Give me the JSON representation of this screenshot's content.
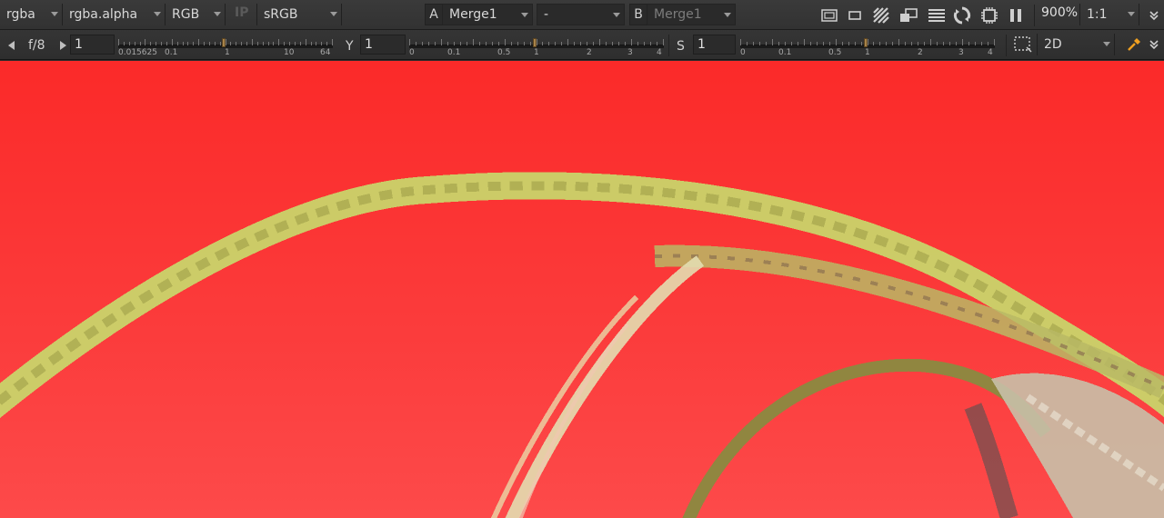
{
  "toolbar_top": {
    "channels": "rgba",
    "alpha_channel": "rgba.alpha",
    "display_channels": "RGB",
    "ip_label": "IP",
    "colorspace": "sRGB",
    "input_a_label": "A",
    "input_a": "Merge1",
    "compare_mode": "-",
    "input_b_label": "B",
    "input_b": "Merge1",
    "zoom": "900%",
    "proxy": "1:1"
  },
  "toolbar_bottom": {
    "fstop": "f/8",
    "gain_value": "1",
    "gain_ticks": [
      "0.015625",
      "0.1",
      "1",
      "10",
      "64"
    ],
    "gamma_label": "Y",
    "gamma_value": "1",
    "gamma_ticks": [
      "0",
      "0.1",
      "0.5",
      "1",
      "2",
      "3",
      "4"
    ],
    "saturation_label": "S",
    "saturation_value": "1",
    "saturation_ticks": [
      "0",
      "0.1",
      "0.5",
      "1",
      "2",
      "3",
      "4"
    ],
    "view_mode": "2D"
  },
  "colors": {
    "background_red": "#fb2a29",
    "slider_handle": "#a8844a",
    "picker_accent": "#f0a020"
  }
}
